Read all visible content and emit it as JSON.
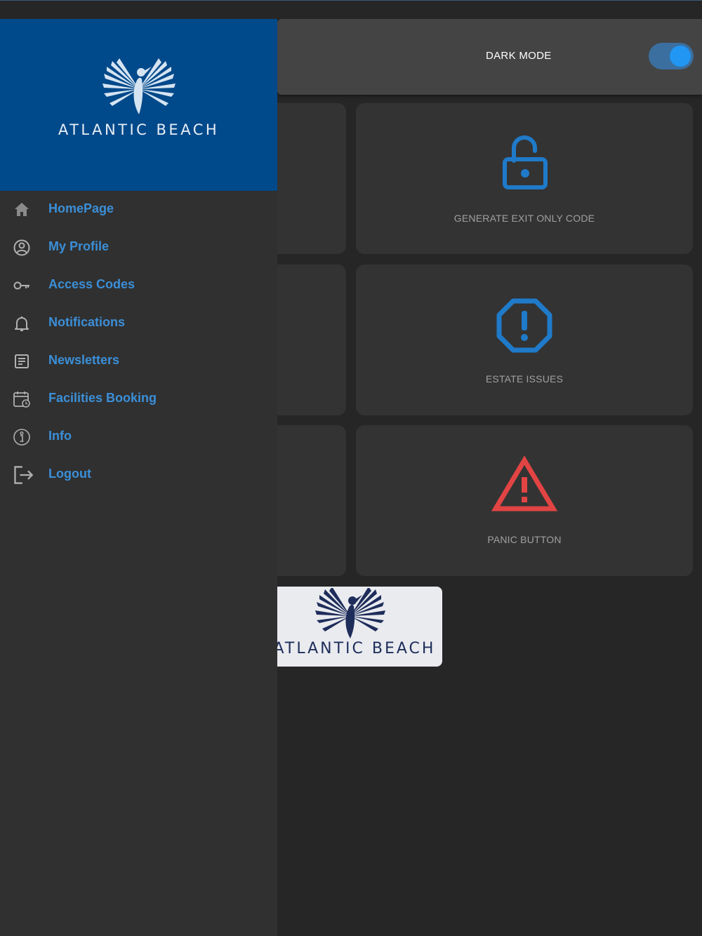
{
  "header": {
    "dark_mode_label": "DARK MODE",
    "dark_mode_on": true
  },
  "tiles": [
    {
      "label": "GENERATE EXIT ONLY CODE",
      "icon": "unlock-icon",
      "color": "#1f7ac9"
    },
    {
      "label": "ESTATE ISSUES",
      "icon": "octagon-alert-icon",
      "color": "#1f7ac9"
    },
    {
      "label": "PANIC BUTTON",
      "icon": "warning-triangle-icon",
      "color": "#e24444"
    }
  ],
  "brand": {
    "name": "ATLANTIC BEACH",
    "card_name": "ATLANTIC BEACH",
    "primary_color": "#00498a"
  },
  "drawer": {
    "items": [
      {
        "label": "HomePage",
        "icon": "home-icon"
      },
      {
        "label": "My Profile",
        "icon": "user-circle-icon"
      },
      {
        "label": "Access Codes",
        "icon": "key-icon"
      },
      {
        "label": "Notifications",
        "icon": "bell-icon"
      },
      {
        "label": "Newsletters",
        "icon": "article-icon"
      },
      {
        "label": "Facilities Booking",
        "icon": "calendar-clock-icon"
      },
      {
        "label": "Info",
        "icon": "info-icon"
      },
      {
        "label": "Logout",
        "icon": "logout-icon"
      }
    ]
  },
  "colors": {
    "accent": "#3b8fd8",
    "background": "#262626",
    "tile": "#333333"
  }
}
